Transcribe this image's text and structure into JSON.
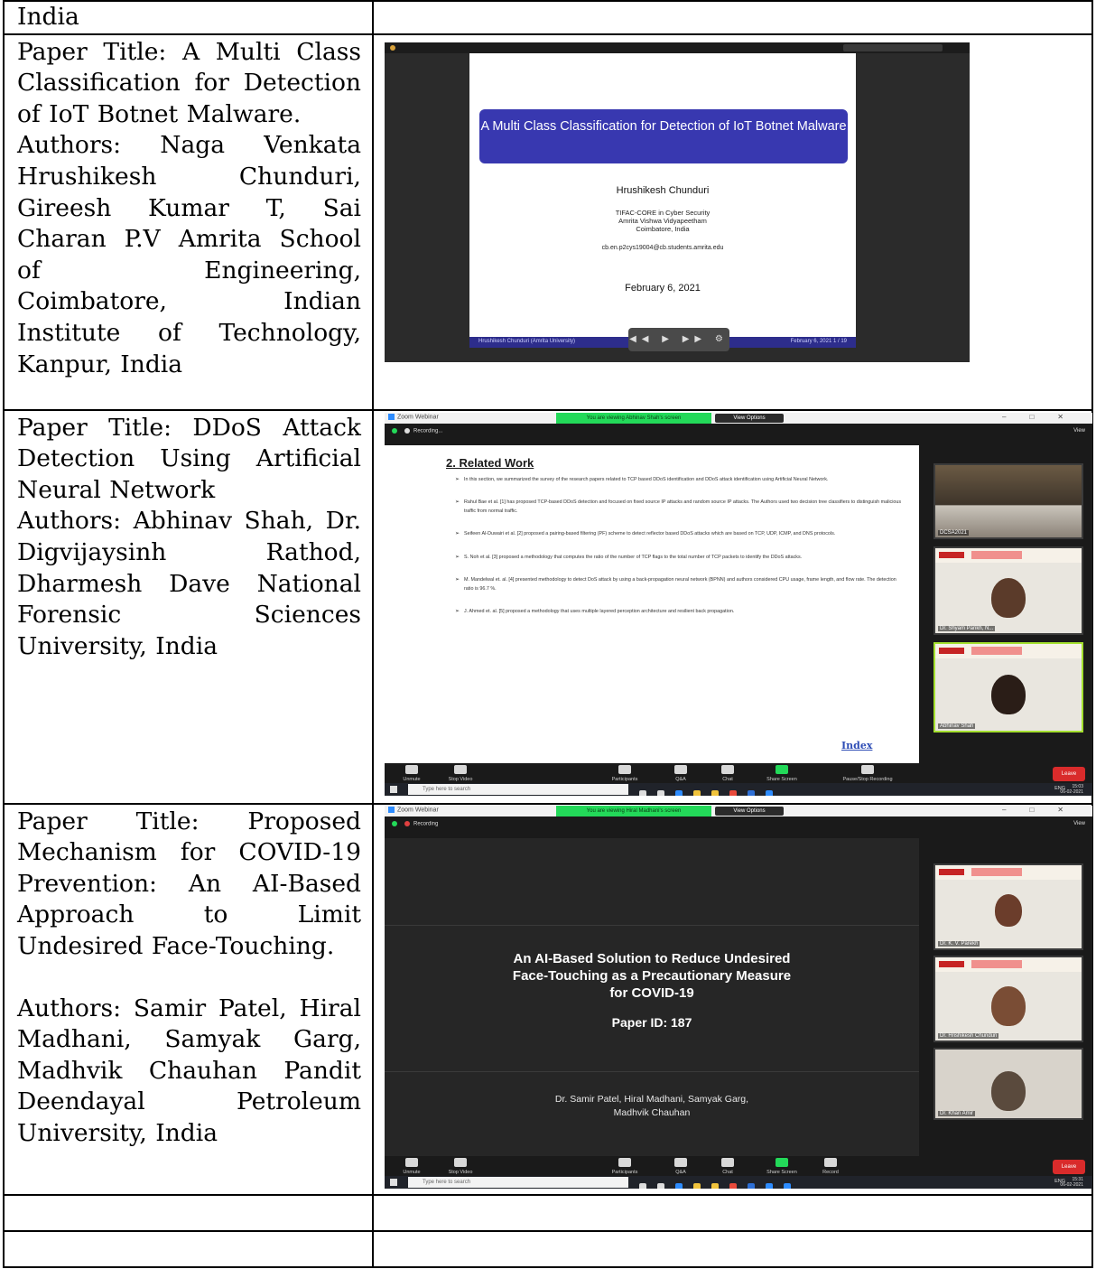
{
  "rows": [
    {
      "text": "India"
    },
    {
      "title": "Paper Title: A Multi Class Classification for Detection of IoT Botnet Malware.",
      "authors": "Authors: Naga Venkata Hrushikesh Chunduri, Gireesh Kumar T, Sai Charan P.V Amrita School of Engineering, Coimbatore, Indian Institute of Technology, Kanpur, India",
      "slide": {
        "banner": "A Multi Class Classification for Detection of IoT Botnet Malware",
        "author": "Hrushikesh Chunduri",
        "affiliation": "TIFAC-CORE in Cyber Security\nAmrita Vishwa Vidyapeetham\nCoimbatore, India",
        "email": "cb.en.p2cys19004@cb.students.amrita.edu",
        "date": "February 6, 2021",
        "footer_left": "Hrushikesh Chunduri (Amrita University)",
        "footer_right": "February 6, 2021   1 / 19"
      }
    },
    {
      "title": "Paper Title: DDoS Attack Detection Using Artificial Neural Network",
      "authors": "Authors: Abhinav Shah, Dr. Digvijaysinh Rathod, Dharmesh Dave National Forensic Sciences University, India",
      "zoom": {
        "window_title": "Zoom Webinar",
        "sharing_banner": "You are viewing Abhinav Shah's screen",
        "view_options": "View Options",
        "recording": "Recording...",
        "view_label": "View",
        "slide_title": "2. Related Work",
        "bullets": [
          "In this section, we summarized the survey of the research papers related to TCP based DDoS identification and DDoS attack identification using Artificial Neural Network.",
          "Rahul Bae et al. [1] has proposed TCP-based DDoS detection and focused on fixed source IP attacks and random source IP attacks. The Authors used two decision tree classifiers to distinguish malicious traffic from normal traffic.",
          "Seifeen Al-Duwairi et al. [2] proposed a pairing-based filtering (PF) scheme to detect reflector based DDoS attacks which are based on TCP, UDP, ICMP, and DNS protocols.",
          "S. Noh et al. [3] proposed a methodology that computes the ratio of the number of TCP flags to the total number of TCP packets to identify the DDoS attacks.",
          "M. Mandelwal et. al. [4] presented methodology to detect DoS attack by using a back-propagation neural network (BPNN) and authors considered CPU usage, frame length, and flow rate. The detection ratio is 96.7 %.",
          "J. Ahmed et. al. [5] proposed a methodology that uses multiple layered perception architecture and resilient back propagation."
        ],
        "index_link": "Index",
        "tile_labels": [
          "DCSA2021",
          "Dr. Shyam Parikh, N...",
          "Abhinav Shah"
        ],
        "controls": [
          "Unmute",
          "Stop Video",
          "Participants",
          "Q&A",
          "Chat",
          "Share Screen",
          "Pause/Stop Recording"
        ],
        "leave": "Leave",
        "search_placeholder": "Type here to search",
        "tray": "ENG",
        "clock_time": "15:03",
        "clock_date": "06-02-2021"
      }
    },
    {
      "title": "Paper Title: Proposed Mechanism for COVID-19 Prevention: An AI-Based Approach to Limit Undesired Face-Touching.",
      "authors": "Authors: Samir Patel, Hiral Madhani, Samyak Garg, Madhvik Chauhan Pandit Deendayal Petroleum University, India",
      "zoom": {
        "window_title": "Zoom Webinar",
        "sharing_banner": "You are viewing Hiral Madhani's screen",
        "view_options": "View Options",
        "recording": "Recording",
        "view_label": "View",
        "slide_title": "An AI-Based Solution to Reduce Undesired\nFace-Touching as a Precautionary Measure\nfor COVID-19",
        "paper_id": "Paper ID: 187",
        "slide_authors": "Dr. Samir Patel, Hiral Madhani, Samyak Garg,\nMadhvik Chauhan",
        "tile_labels": [
          "Dr. K. V. Parekh",
          "Dr. Hrishikesh Chunduri",
          "Dr. Khan Amir"
        ],
        "controls": [
          "Unmute",
          "Stop Video",
          "Participants",
          "Q&A",
          "Chat",
          "Share Screen",
          "Record"
        ],
        "leave": "Leave",
        "search_placeholder": "Type here to search",
        "tray": "ENG",
        "clock_time": "15:31",
        "clock_date": "06-02-2021"
      }
    },
    {
      "text": ""
    },
    {
      "text": ""
    }
  ],
  "colors": {
    "banner_blue": "#3838b0",
    "zoom_green": "#23d959",
    "leave_red": "#d92b2b",
    "index_blue": "#2f4eb6"
  }
}
